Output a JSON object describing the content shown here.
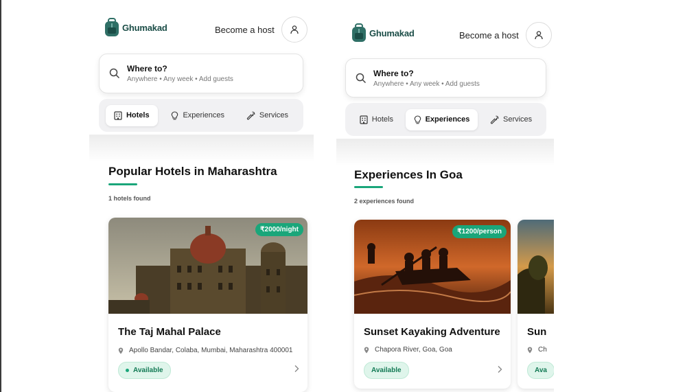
{
  "brand": {
    "name": "Ghumakad",
    "color": "#1b4d47"
  },
  "header": {
    "host_label": "Become a host"
  },
  "search": {
    "title": "Where to?",
    "subtitle": "Anywhere • Any week • Add guests"
  },
  "tabs": [
    {
      "label": "Hotels",
      "icon": "building-icon"
    },
    {
      "label": "Experiences",
      "icon": "lightbulb-icon"
    },
    {
      "label": "Services",
      "icon": "wrench-icon"
    }
  ],
  "accent": "#1aa67a",
  "screens": [
    {
      "active_tab": "Hotels",
      "section_title": "Popular Hotels in Maharashtra",
      "count": "1 hotels found",
      "cards": [
        {
          "title": "The Taj Mahal Palace",
          "location": "Apollo Bandar, Colaba, Mumbai, Maharashtra 400001",
          "price": "₹2000/night",
          "status": "Available"
        }
      ]
    },
    {
      "active_tab": "Experiences",
      "section_title": "Experiences In Goa",
      "count": "2 experiences found",
      "cards": [
        {
          "title": "Sunset Kayaking Adventure",
          "location": "Chapora River, Goa, Goa",
          "price": "₹1200/person",
          "status": "Available"
        },
        {
          "title": "Sun",
          "location": "Ch",
          "status": "Ava"
        }
      ]
    }
  ]
}
